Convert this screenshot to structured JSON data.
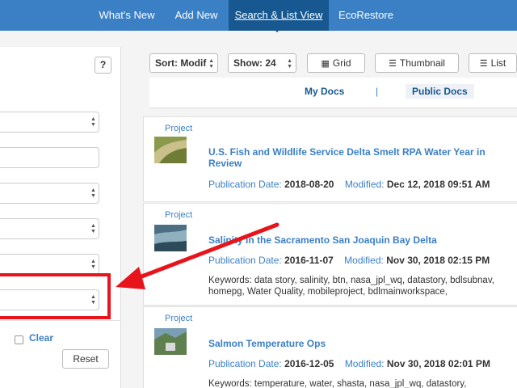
{
  "nav": {
    "tabs": [
      {
        "label": "What's New"
      },
      {
        "label": "Add New"
      },
      {
        "label": "Search & List View",
        "active": true
      },
      {
        "label": "EcoRestore"
      }
    ]
  },
  "left_panel": {
    "help_label": "?",
    "clear_label": "Clear",
    "reset_label": "Reset"
  },
  "toolbar": {
    "sort_label": "Sort: Modif",
    "show_label": "Show: 24",
    "grid_label": "Grid",
    "thumbnail_label": "Thumbnail",
    "list_label": "List"
  },
  "doc_tabs": {
    "my_docs": "My Docs",
    "separator": "|",
    "public_docs": "Public Docs"
  },
  "results": [
    {
      "type": "Project",
      "title": "U.S. Fish and Wildlife Service Delta Smelt RPA Water Year in Review",
      "pub_label": "Publication Date:",
      "pub_date": "2018-08-20",
      "mod_label": "Modified:",
      "modified": "Dec 12, 2018 09:51 AM",
      "keywords": ""
    },
    {
      "type": "Project",
      "title": "Salinity in the Sacramento San Joaquin Bay Delta",
      "pub_label": "Publication Date:",
      "pub_date": "2016-11-07",
      "mod_label": "Modified:",
      "modified": "Nov 30, 2018 02:15 PM",
      "keywords": "Keywords: data story, salinity, btn, nasa_jpl_wq, datastory, bdlsubnav, homepg, Water Quality, mobileproject, bdlmainworkspace,"
    },
    {
      "type": "Project",
      "title": "Salmon Temperature Ops",
      "pub_label": "Publication Date:",
      "pub_date": "2016-12-05",
      "mod_label": "Modified:",
      "modified": "Nov 30, 2018 02:01 PM",
      "keywords": "Keywords: temperature, water, shasta, nasa_jpl_wq, datastory,"
    }
  ],
  "colors": {
    "nav_bg": "#3b7fc4",
    "nav_active": "#175890",
    "link": "#3b7fc4",
    "annotation_red": "#e8141c"
  }
}
